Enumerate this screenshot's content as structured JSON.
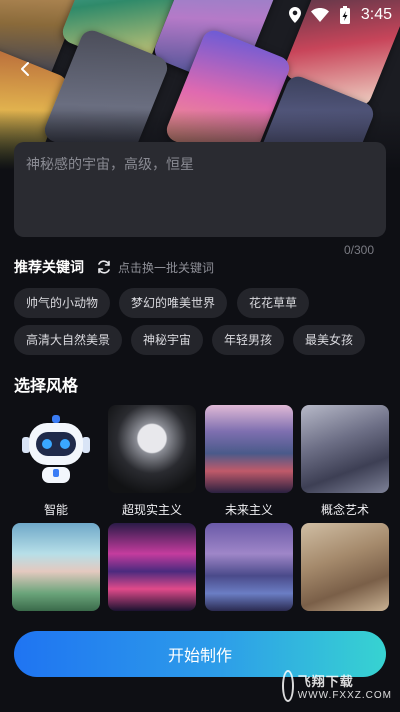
{
  "status_bar": {
    "time": "3:45"
  },
  "prompt": {
    "placeholder": "神秘感的宇宙，高级，恒星",
    "value": "",
    "counter": "0/300"
  },
  "keywords": {
    "title": "推荐关键词",
    "refresh_label": "点击换一批关键词",
    "chips": [
      "帅气的小动物",
      "梦幻的唯美世界",
      "花花草草",
      "高清大自然美景",
      "神秘宇宙",
      "年轻男孩",
      "最美女孩"
    ]
  },
  "styles": {
    "title": "选择风格",
    "items": [
      {
        "label": "智能"
      },
      {
        "label": "超现实主义"
      },
      {
        "label": "未来主义"
      },
      {
        "label": "概念艺术"
      },
      {
        "label": ""
      },
      {
        "label": ""
      },
      {
        "label": ""
      },
      {
        "label": ""
      }
    ]
  },
  "cta": {
    "label": "开始制作"
  },
  "watermark": {
    "line1": "飞翔下载",
    "line2": "WWW.FXXZ.COM"
  },
  "colors": {
    "accent_start": "#1f74f2",
    "accent_end": "#37d3d1",
    "background": "#0e0f14",
    "chip": "#24252b"
  }
}
